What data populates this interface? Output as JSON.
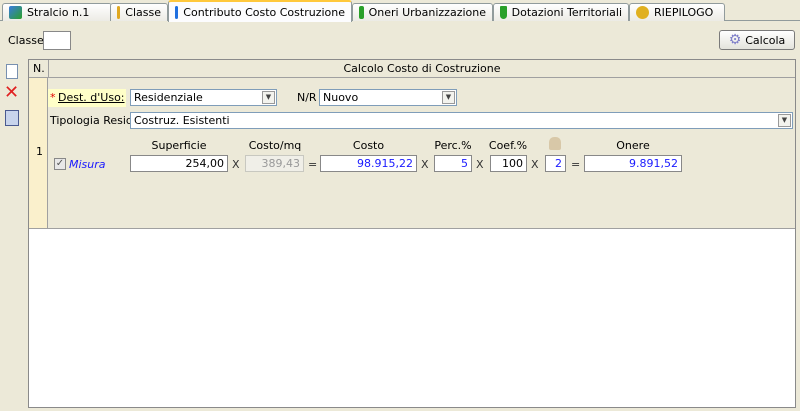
{
  "tabs": [
    {
      "label": "Stralcio n.1",
      "icon": "blocks-icon",
      "color": "#3a7be0"
    },
    {
      "label": "Classe",
      "icon": "cube-icon",
      "color": "#e0a820"
    },
    {
      "label": "Contributo Costo Costruzione",
      "icon": "cube-icon",
      "color": "#1f6fe0"
    },
    {
      "label": "Oneri Urbanizzazione",
      "icon": "cube-icon",
      "color": "#2aa02a"
    },
    {
      "label": "Dotazioni Territoriali",
      "icon": "shield-icon",
      "color": "#2aa02a"
    },
    {
      "label": "RIEPILOGO",
      "icon": "money-bag-icon",
      "color": "#e0b020"
    }
  ],
  "toolbar": {
    "classe_label": "Classe",
    "classe_value": "",
    "calcola_label": "Calcola"
  },
  "grid": {
    "col_n": "N.",
    "col_title": "Calcolo Costo di Costruzione",
    "row_number": "1"
  },
  "form": {
    "dest_label": "Dest. d'Uso:",
    "required_mark": "*",
    "dest_value": "Residenziale",
    "nr_label": "N/R",
    "nr_value": "Nuovo",
    "tipologia_label": "Tipologia Resid.",
    "tipologia_value": "Costruz. Esistenti",
    "misura_label": "Misura",
    "misura_checked": true,
    "headers": {
      "superficie": "Superficie",
      "costo_mq": "Costo/mq",
      "costo": "Costo",
      "perc": "Perc.%",
      "coef": "Coef.%",
      "onere": "Onere"
    },
    "values": {
      "superficie": "254,00",
      "costo_mq": "389,43",
      "costo": "98.915,22",
      "perc": "5",
      "coef": "100",
      "moltiplicatore": "2",
      "onere": "9.891,52"
    },
    "ops": {
      "x": "X",
      "eq": "="
    }
  }
}
